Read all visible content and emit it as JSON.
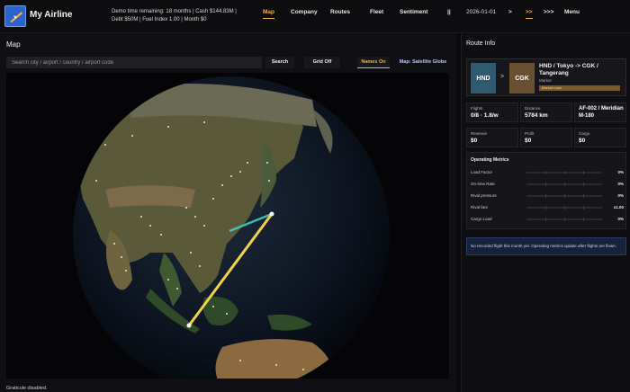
{
  "app": {
    "title": "My Airline"
  },
  "stats": {
    "line1": "Demo time remaining: 18 months  |  Cash $144.83M  |",
    "line2": "Debt $50M  |  Fuel Index 1.00  |  Month $0"
  },
  "nav": {
    "map": "Map",
    "company": "Company",
    "routes": "Routes",
    "fleet": "Fleet",
    "sentiment": "Sentiment",
    "pause": "||",
    "date": "2026-01-01",
    "speed1": ">",
    "speed2": ">>",
    "speed3": ">>>",
    "menu": "Menu"
  },
  "map": {
    "title": "Map",
    "search_placeholder": "Search city / airport / country / airport code",
    "search_btn": "Search",
    "grid_btn": "Grid Off",
    "names_btn": "Names On",
    "mode_btn": "Map: Satellite Globe",
    "status": "Graticule disabled."
  },
  "route_info": {
    "title": "Route Info",
    "from_code": "HND",
    "arrow": ">",
    "to_code": "CGK",
    "route_name": "HND / Tokyo -> CGK / Tangerang",
    "market_label": "Market",
    "market_badge": "Market route",
    "flights_label": "Flights",
    "flights_value": "0/8 · 1.8/w",
    "distance_label": "Distance",
    "distance_value": "5784 km",
    "aircraft_value": "AF-002 / Meridian M-180",
    "revenue_label": "Revenue",
    "revenue_value": "$0",
    "profit_label": "Profit",
    "profit_value": "$0",
    "cargo_label": "Cargo",
    "cargo_value": "$0",
    "metrics_title": "Operating Metrics",
    "metrics": [
      {
        "label": "Load Factor",
        "value": "0%"
      },
      {
        "label": "On-time Rate",
        "value": "0%"
      },
      {
        "label": "Rival pressure",
        "value": "0%"
      },
      {
        "label": "Rival fare",
        "value": "x1.00"
      },
      {
        "label": "Cargo Load",
        "value": "0%"
      }
    ],
    "notice": "No recorded flight this month yet. Operating metrics update after flights are flown."
  },
  "colors": {
    "accent": "#f3b14a",
    "route_primary": "#f2d24a",
    "route_secondary": "#3fd8c8",
    "from_tile": "#2f5a6f",
    "to_tile": "#6a4f33"
  }
}
